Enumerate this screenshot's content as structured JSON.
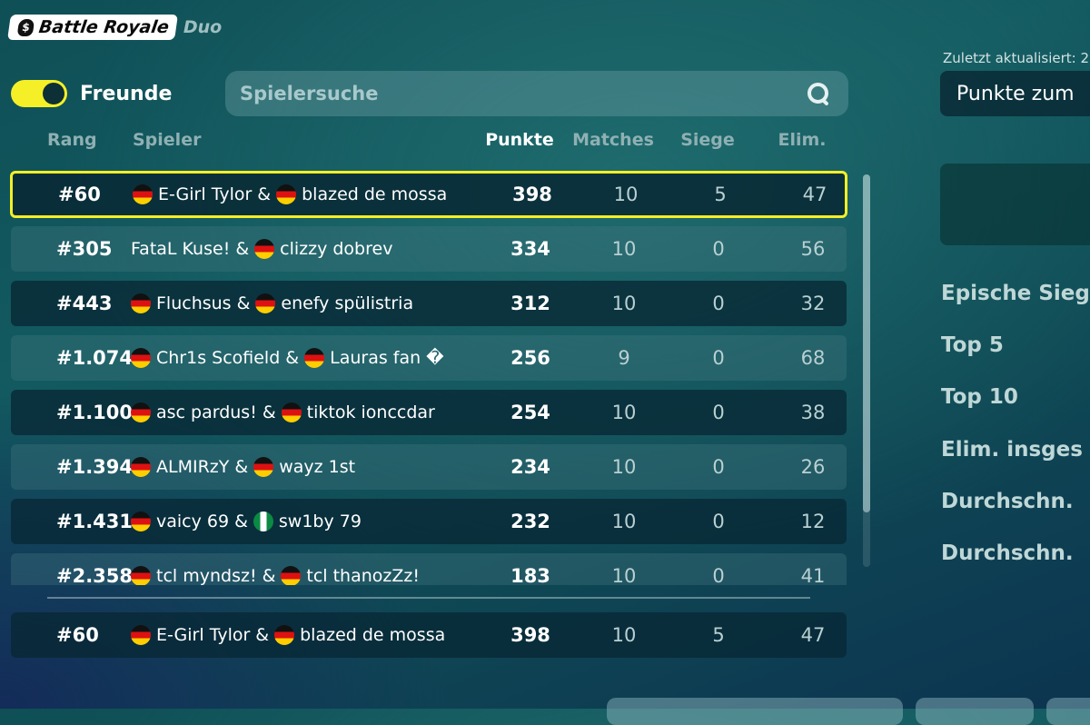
{
  "header": {
    "mode": "Battle Royale",
    "sub": "Duo"
  },
  "friends_toggle": {
    "label": "Freunde",
    "on": true,
    "color": "#f4ef27"
  },
  "search": {
    "placeholder": "Spielersuche"
  },
  "columns": {
    "rank": "Rang",
    "player": "Spieler",
    "points": "Punkte",
    "matches": "Matches",
    "wins": "Siege",
    "elims": "Elim."
  },
  "rows": [
    {
      "rank": "#60",
      "p1": "E-Girl Tylor",
      "p1_flag": "de",
      "p2": "blazed de mossa",
      "p2_flag": "de",
      "points": "398",
      "matches": "10",
      "wins": "5",
      "elims": "47",
      "selected": true
    },
    {
      "rank": "#305",
      "p1": "FataL Kuse!",
      "p1_flag": "",
      "p2": "clizzy dobrev",
      "p2_flag": "de",
      "points": "334",
      "matches": "10",
      "wins": "0",
      "elims": "56"
    },
    {
      "rank": "#443",
      "p1": "Fluchsus",
      "p1_flag": "de",
      "p2": "enefy spülistria",
      "p2_flag": "de",
      "points": "312",
      "matches": "10",
      "wins": "0",
      "elims": "32"
    },
    {
      "rank": "#1.074",
      "p1": "Chr1s Scofield",
      "p1_flag": "de",
      "p2": "Lauras fan �",
      "p2_flag": "de",
      "points": "256",
      "matches": "9",
      "wins": "0",
      "elims": "68"
    },
    {
      "rank": "#1.100",
      "p1": "asc pardus!",
      "p1_flag": "de",
      "p2": "tiktok ionccdar",
      "p2_flag": "de",
      "points": "254",
      "matches": "10",
      "wins": "0",
      "elims": "38"
    },
    {
      "rank": "#1.394",
      "p1": "ALMIRzY",
      "p1_flag": "de",
      "p2": "wayz 1st",
      "p2_flag": "de",
      "points": "234",
      "matches": "10",
      "wins": "0",
      "elims": "26"
    },
    {
      "rank": "#1.431",
      "p1": "vaicy 69",
      "p1_flag": "de",
      "p2": "sw1by 79",
      "p2_flag": "ng",
      "points": "232",
      "matches": "10",
      "wins": "0",
      "elims": "12"
    },
    {
      "rank": "#2.358",
      "p1": "tcl myndsz!",
      "p1_flag": "de",
      "p2": "tcl thanozZz!",
      "p2_flag": "de",
      "points": "183",
      "matches": "10",
      "wins": "0",
      "elims": "41"
    }
  ],
  "pinned_row": {
    "rank": "#60",
    "p1": "E-Girl Tylor",
    "p1_flag": "de",
    "p2": "blazed de mossa",
    "p2_flag": "de",
    "points": "398",
    "matches": "10",
    "wins": "5",
    "elims": "47"
  },
  "right_panel": {
    "updated": "Zuletzt aktualisiert: 2",
    "dropdown": "Punkte zum",
    "stats": [
      "Epische Sieg",
      "Top 5",
      "Top 10",
      "Elim. insges",
      "Durchschn.",
      "Durchschn."
    ]
  },
  "icons": {
    "mode": "money-bag-icon",
    "search": "search-icon"
  }
}
